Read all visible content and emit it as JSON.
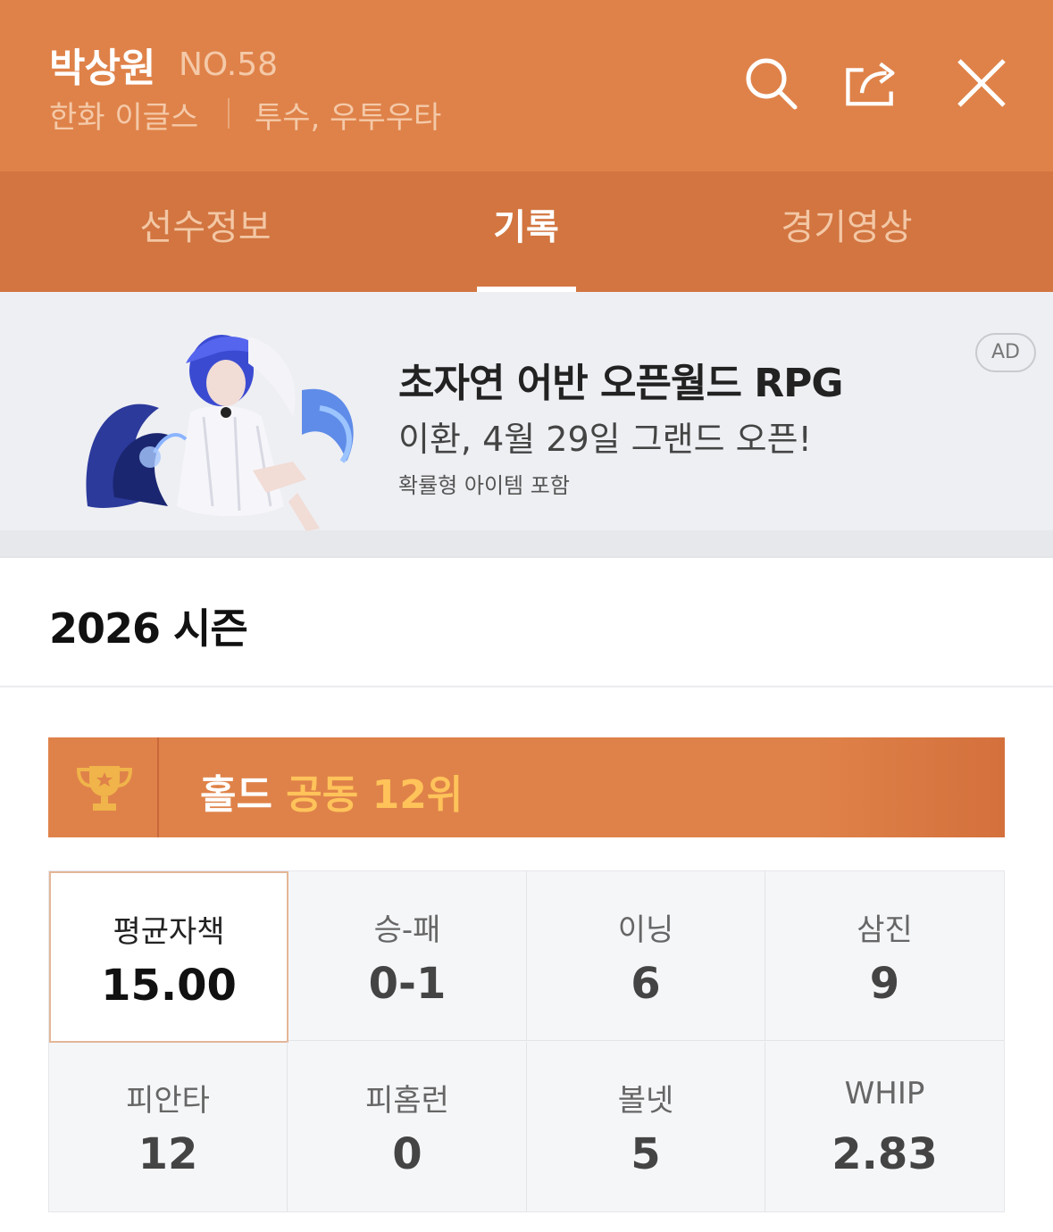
{
  "header": {
    "name": "박상원",
    "number": "NO.58",
    "team": "한화 이글스",
    "position": "투수, 우투우타",
    "icons": [
      "search-icon",
      "share-icon",
      "close-icon"
    ]
  },
  "tabs": [
    {
      "label": "선수정보",
      "active": false
    },
    {
      "label": "기록",
      "active": true
    },
    {
      "label": "경기영상",
      "active": false
    }
  ],
  "ad": {
    "title": "초자연 어반 오픈월드 RPG",
    "subtitle": "이환, 4월 29일 그랜드 오픈!",
    "note": "확률형 아이템 포함",
    "badge": "AD"
  },
  "season": {
    "title": "2026 시즌"
  },
  "rank": {
    "category": "홀드",
    "value": "공동 12위",
    "icon": "trophy-icon"
  },
  "stats": [
    {
      "label": "평균자책",
      "value": "15.00"
    },
    {
      "label": "승-패",
      "value": "0-1"
    },
    {
      "label": "이닝",
      "value": "6"
    },
    {
      "label": "삼진",
      "value": "9"
    },
    {
      "label": "피안타",
      "value": "12"
    },
    {
      "label": "피홈런",
      "value": "0"
    },
    {
      "label": "볼넷",
      "value": "5"
    },
    {
      "label": "WHIP",
      "value": "2.83"
    }
  ],
  "colors": {
    "header": "#df8249",
    "tabs": "#d27540",
    "rank_highlight": "#ffc35a"
  }
}
